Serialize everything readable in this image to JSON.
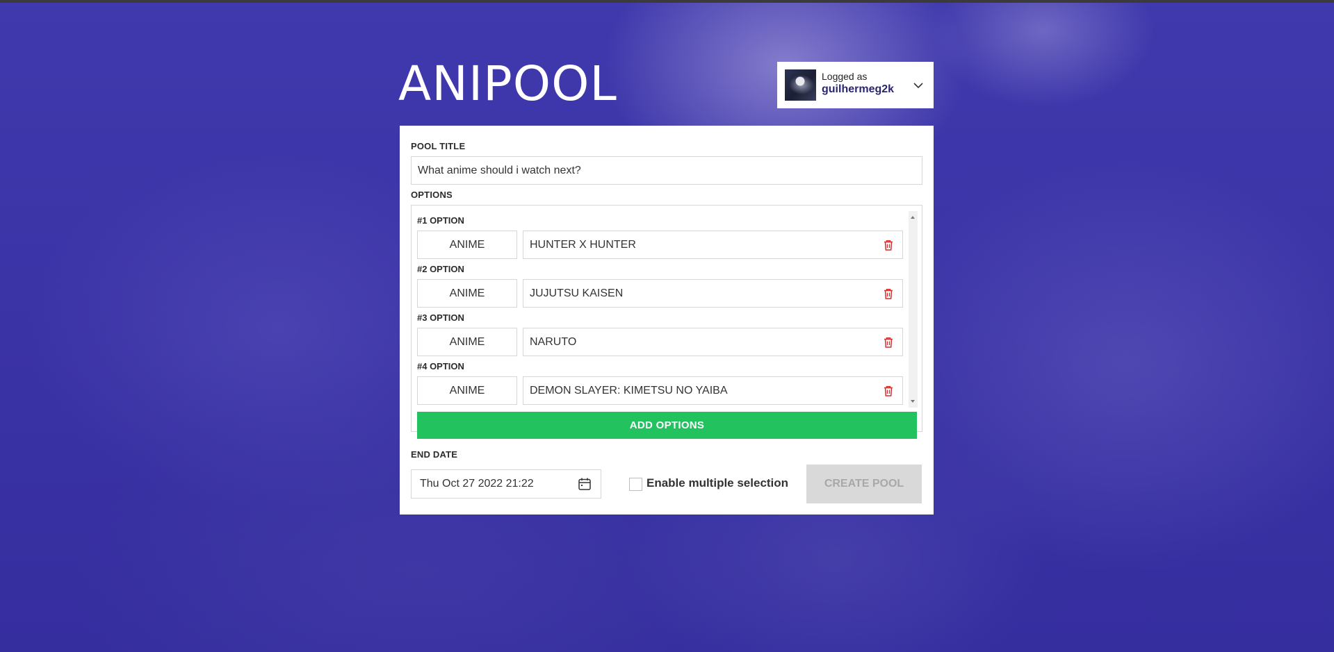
{
  "app": {
    "logo_text": "ANIPOOL"
  },
  "user": {
    "logged_as_label": "Logged as",
    "username": "guilhermeg2k",
    "avatar_icon": "avatar-image",
    "menu_icon": "chevron-down-icon"
  },
  "form": {
    "pool_title_label": "POOL TITLE",
    "pool_title_value": "What anime should i watch next?",
    "options_label": "OPTIONS",
    "options": [
      {
        "label": "#1 OPTION",
        "type": "ANIME",
        "name": "HUNTER X HUNTER"
      },
      {
        "label": "#2 OPTION",
        "type": "ANIME",
        "name": "JUJUTSU KAISEN"
      },
      {
        "label": "#3 OPTION",
        "type": "ANIME",
        "name": "NARUTO"
      },
      {
        "label": "#4 OPTION",
        "type": "ANIME",
        "name": "DEMON SLAYER: KIMETSU NO YAIBA"
      }
    ],
    "add_options_label": "ADD OPTIONS",
    "end_date_label": "END DATE",
    "end_date_value": "Thu Oct 27 2022 21:22",
    "multiple_selection_label": "Enable multiple selection",
    "multiple_selection_checked": false,
    "create_button_label": "CREATE POOL"
  },
  "colors": {
    "background": "#3a34a6",
    "accent_green": "#22c35e",
    "delete_red": "#d32f2f",
    "username_text": "#2a2570",
    "disabled_button": "#d9d9d9"
  }
}
